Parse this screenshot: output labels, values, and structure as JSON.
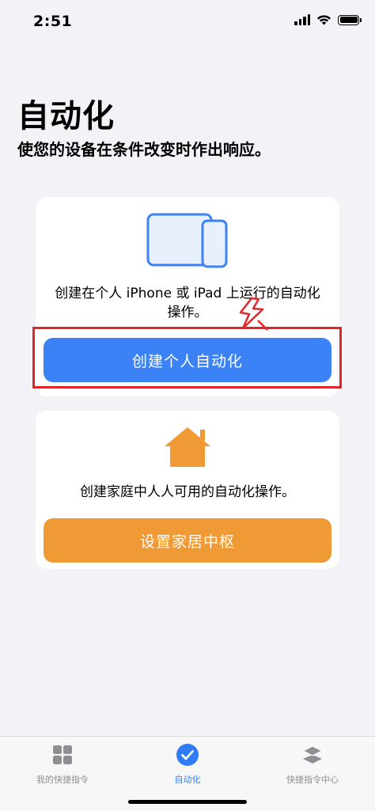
{
  "status_bar": {
    "time": "2:51"
  },
  "header": {
    "title": "自动化",
    "subtitle": "使您的设备在条件改变时作出响应。"
  },
  "personal_card": {
    "description": "创建在个人 iPhone 或 iPad 上运行的自动化操作。",
    "button_label": "创建个人自动化"
  },
  "home_card": {
    "description": "创建家庭中人人可用的自动化操作。",
    "button_label": "设置家居中枢"
  },
  "tab_bar": {
    "tabs": [
      {
        "label": "我的快捷指令",
        "icon": "grid-icon",
        "selected": false
      },
      {
        "label": "自动化",
        "icon": "checkmark-circle-icon",
        "selected": true
      },
      {
        "label": "快捷指令中心",
        "icon": "layers-icon",
        "selected": false
      }
    ]
  },
  "colors": {
    "accent_blue": "#3b82f6",
    "accent_orange": "#f09a35",
    "highlight_red": "#e0262b",
    "background": "#f2f2f7"
  }
}
